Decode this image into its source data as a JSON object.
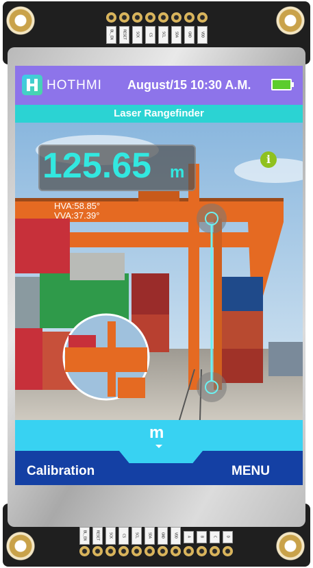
{
  "header": {
    "brand": "HOTHMI",
    "datetime": "August/15  10:30 A.M."
  },
  "subtitle": "Laser Rangefinder",
  "measurement": {
    "distance": "125.65",
    "unit": "m",
    "hva": "HVA:58.85°",
    "vva": "VVA:37.39°"
  },
  "info_icon": "i",
  "unit_selector": "m",
  "bottom": {
    "calibration": "Calibration",
    "menu": "MENU"
  },
  "pins_top": [
    "BL_EN",
    "RESET",
    "SCK",
    "CS",
    "SCL",
    "SDA",
    "GND",
    "VDD"
  ],
  "pins_bottom": [
    "BL_EN",
    "RESET",
    "SCK",
    "CS",
    "SCL",
    "SDA",
    "GND",
    "VDD",
    "A",
    "B",
    "C",
    "D"
  ],
  "colors": {
    "titlebar": "#8d74ea",
    "subtitle": "#2bd3d3",
    "accent": "#32e8e0",
    "unitbar": "#38d2f2",
    "bottombar": "#1440a4",
    "info": "#8fc11f"
  }
}
